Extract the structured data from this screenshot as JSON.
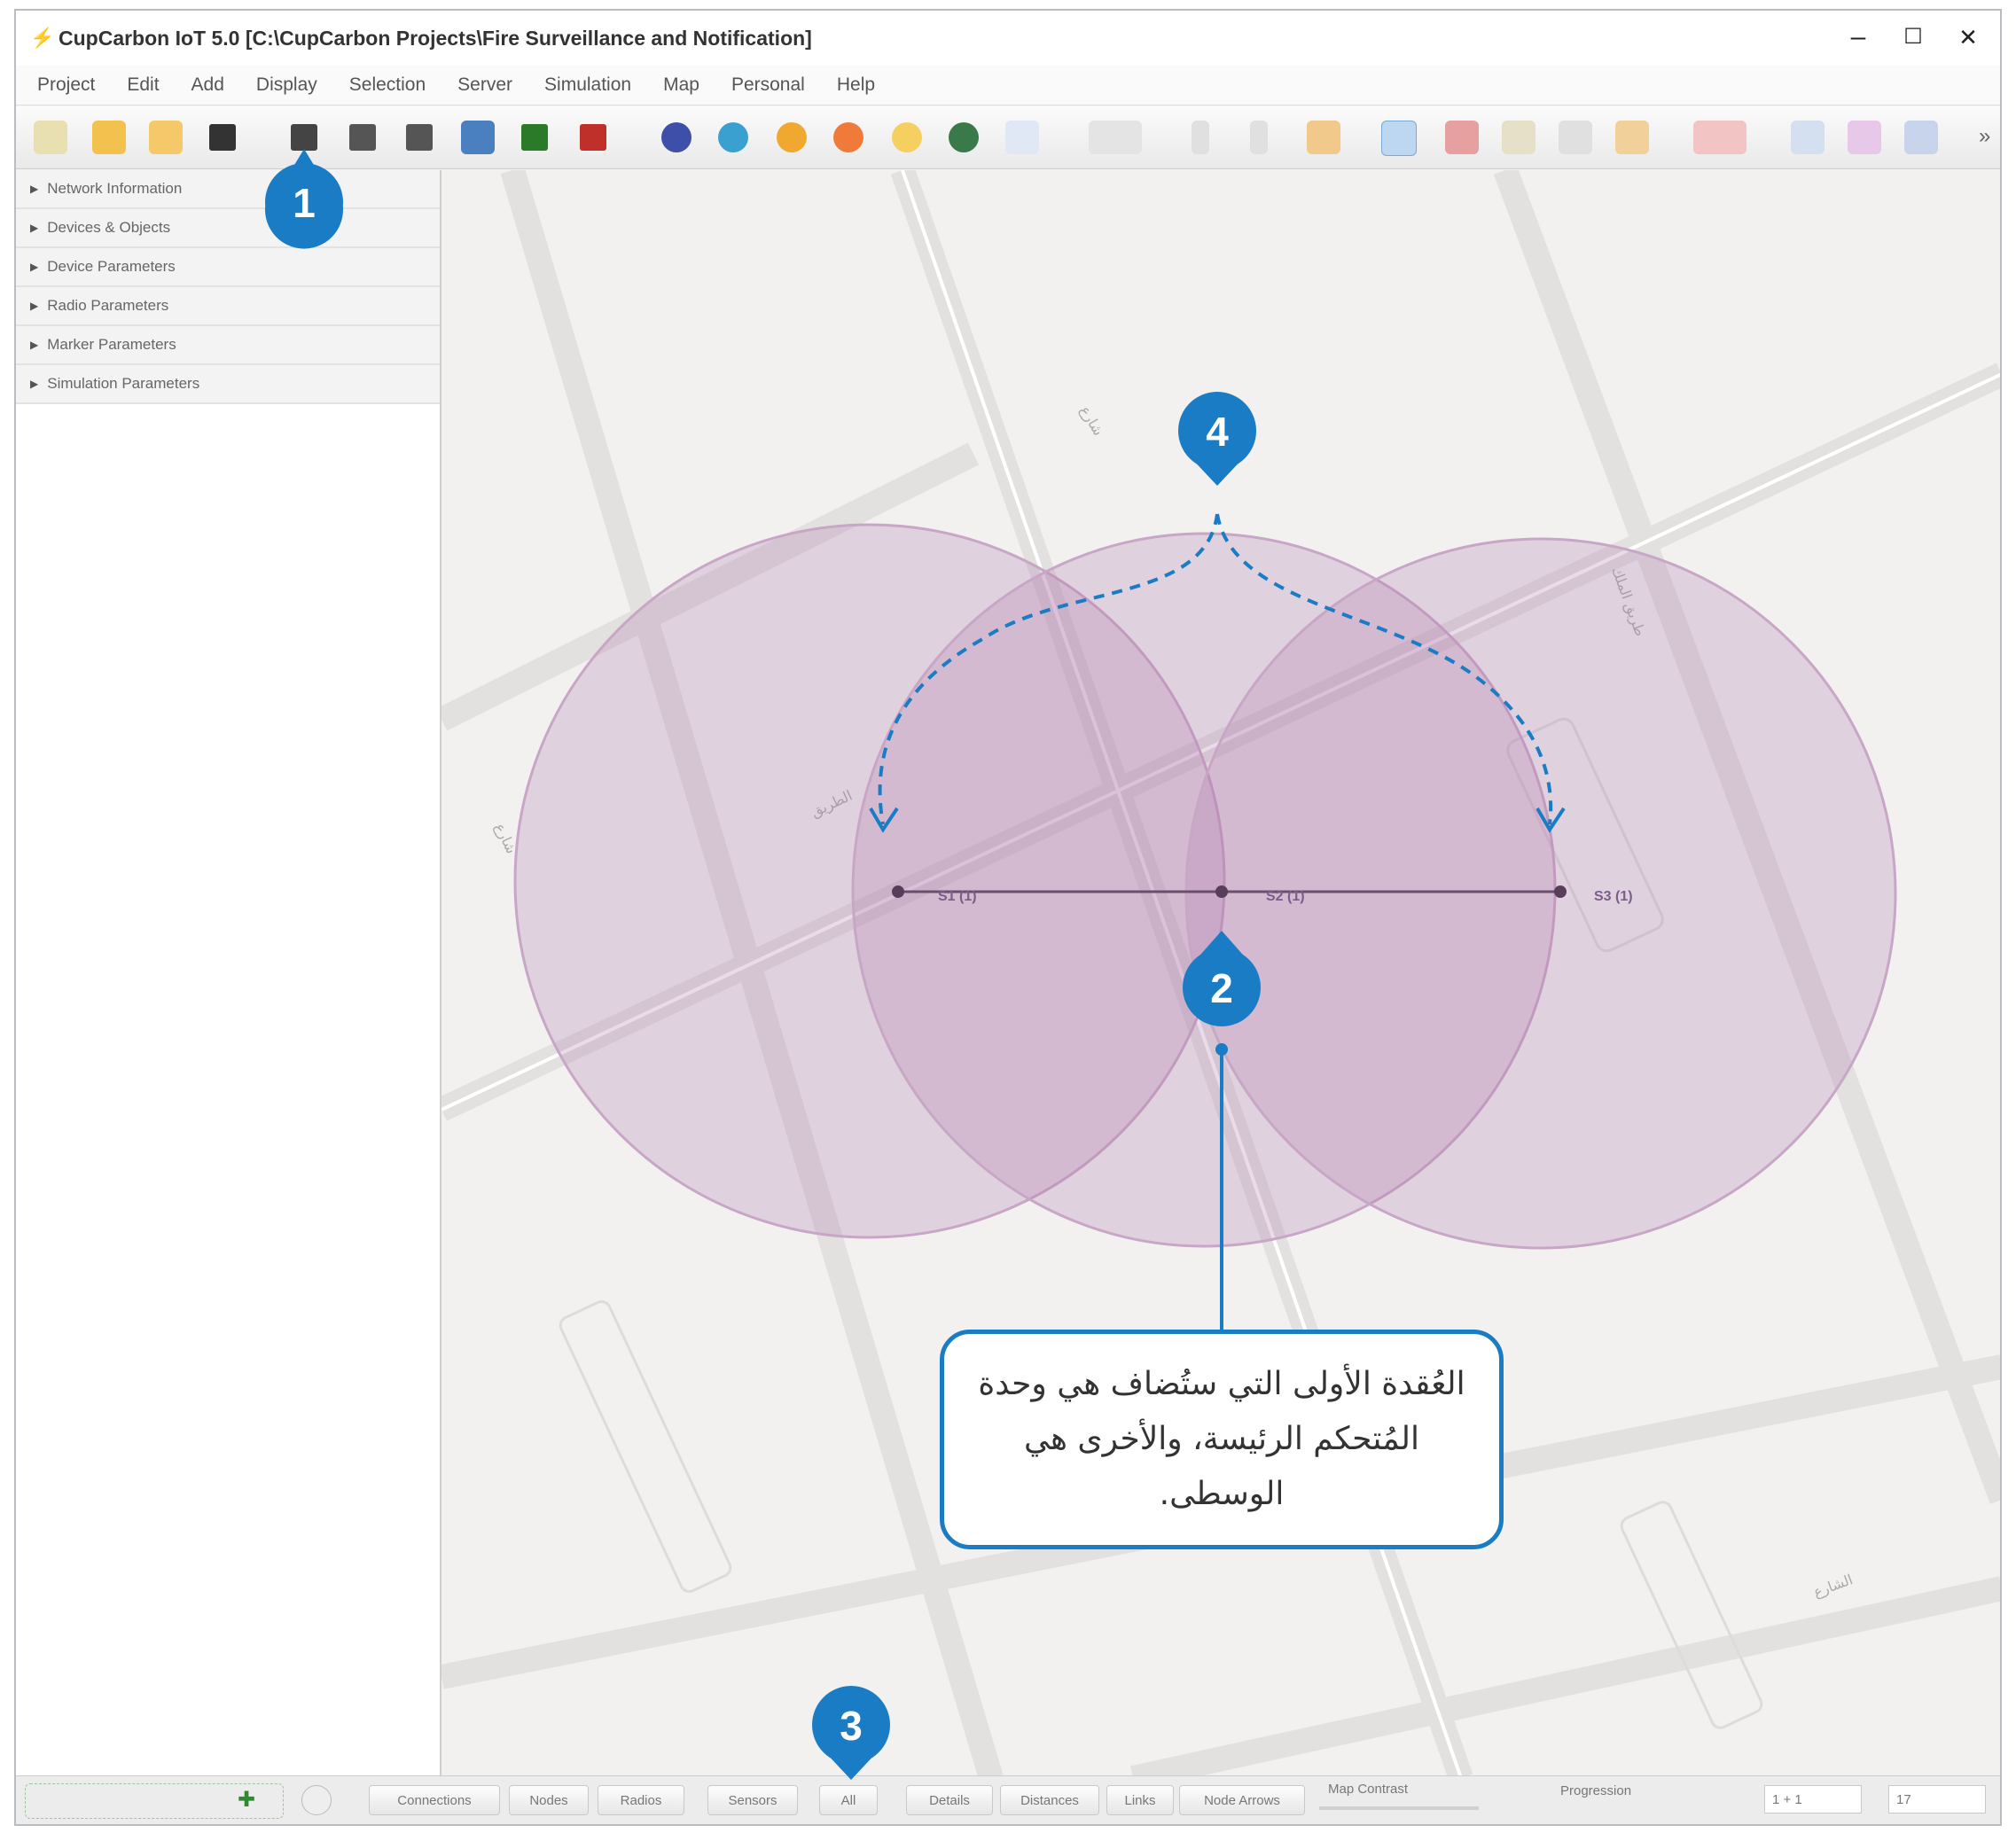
{
  "window": {
    "title": "CupCarbon IoT 5.0 [C:\\CupCarbon Projects\\Fire Surveillance and Notification]",
    "controls": {
      "minimize": "–",
      "maximize": "☐",
      "close": "✕"
    }
  },
  "menubar": {
    "items": [
      "Project",
      "Edit",
      "Add",
      "Display",
      "Selection",
      "Server",
      "Simulation",
      "Map",
      "Personal",
      "Help"
    ]
  },
  "toolbar": {
    "overflow": "»"
  },
  "sidebar": {
    "items": [
      "Network Information",
      "Devices & Objects",
      "Device Parameters",
      "Radio Parameters",
      "Marker Parameters",
      "Simulation Parameters"
    ]
  },
  "map": {
    "nodes": [
      "S1 (1)",
      "S2 (1)",
      "S3 (1)"
    ]
  },
  "statusbar": {
    "buttons": [
      "Connections",
      "Nodes",
      "Radios",
      "Sensors",
      "All",
      "Details",
      "Distances",
      "Links",
      "Node Arrows"
    ],
    "map_contrast": "Map Contrast",
    "progression": "Progression",
    "field1": "1 + 1",
    "field2": "17"
  },
  "annotations": {
    "markers": [
      "1",
      "2",
      "3",
      "4"
    ],
    "callout": "العُقدة الأولى التي ستُضاف هي وحدة المُتحكم الرئيسة، والأخرى هي الوسطى.",
    "accent": "#1a7cc4"
  }
}
